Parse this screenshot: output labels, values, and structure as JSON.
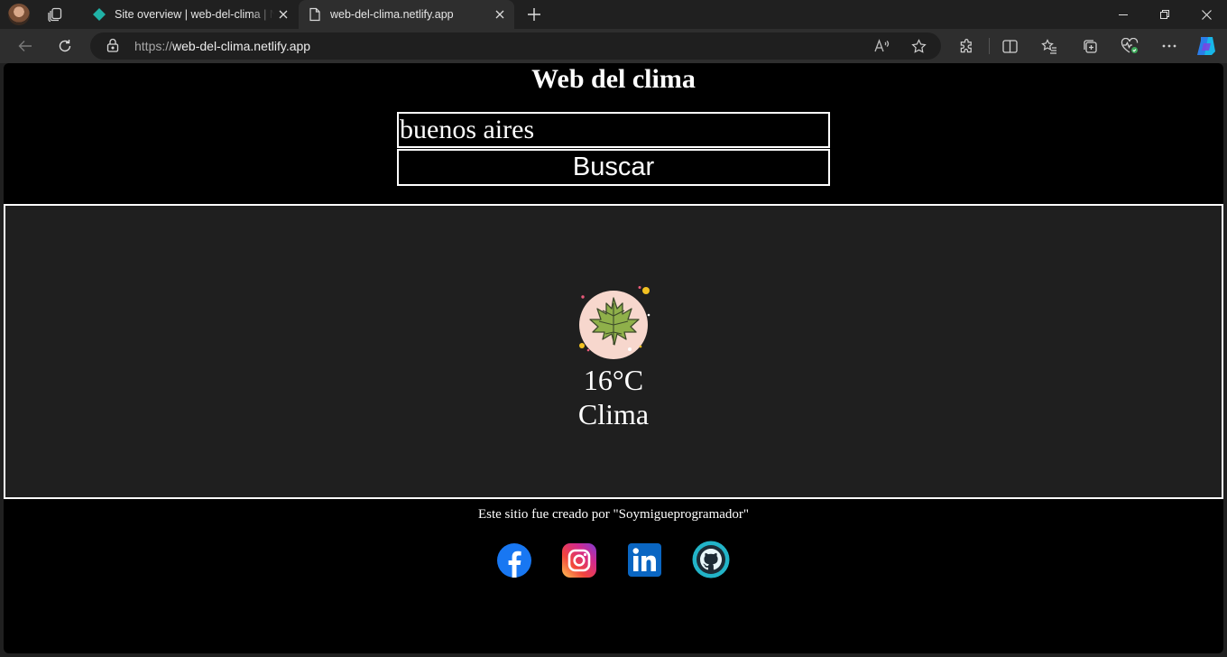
{
  "browser": {
    "tabs": [
      {
        "title": "Site overview | web-del-clima | Netlify",
        "favicon": "netlify-icon",
        "active": false
      },
      {
        "title": "web-del-clima.netlify.app",
        "favicon": "page-icon",
        "active": true
      }
    ],
    "url": {
      "scheme": "https://",
      "host": "web-del-clima.netlify.app"
    }
  },
  "page": {
    "title": "Web del clima",
    "search": {
      "value": "buenos aires"
    },
    "button_label": "Buscar",
    "weather": {
      "icon": "maple-leaf-icon",
      "temperature": "16°C",
      "description": "Clima"
    },
    "footer_text": "Este sitio fue creado por \"Soymigueprogramador\"",
    "social": [
      "facebook-icon",
      "instagram-icon",
      "linkedin-icon",
      "github-icon"
    ]
  },
  "colors": {
    "page_bg": "#000000",
    "card_bg": "#1f1f1f",
    "text": "#ffffff",
    "chrome_bg": "#202020",
    "toolbar_bg": "#2e2e2e"
  }
}
